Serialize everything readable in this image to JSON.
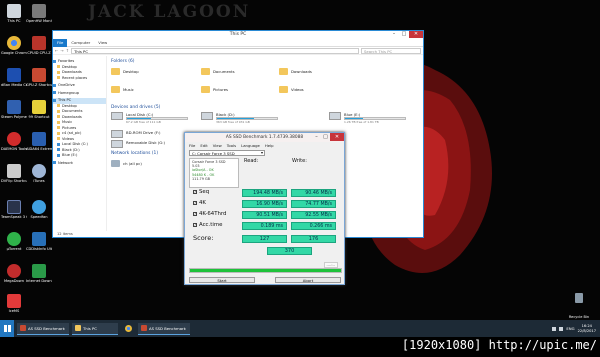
{
  "desktop": {
    "wallpaper_title": "JACK LAGOON",
    "icons_left": [
      {
        "label": "This PC",
        "color": "#cfd6dd"
      },
      {
        "label": "Google Chrome",
        "color": "#e7b83a"
      },
      {
        "label": "dBan Media Center 18",
        "color": "#1d4fb0"
      },
      {
        "label": "Steam Polymer",
        "color": "#3060b0"
      },
      {
        "label": "DAEMON Tools Lite",
        "color": "#d22c2c"
      },
      {
        "label": "DVFlip Shortcut",
        "color": "#cccccc"
      },
      {
        "label": "TeamSpeak 3 Client",
        "color": "#29334a"
      },
      {
        "label": "µTorrent",
        "color": "#2fb24a"
      },
      {
        "label": "MegaDown",
        "color": "#c22c2c"
      },
      {
        "label": "IceMS",
        "color": "#e23a3a"
      }
    ],
    "icons_col2": [
      {
        "label": "OpenHW Monitor",
        "color": "#7a7a7a"
      },
      {
        "label": "CPUID CPU-Z",
        "color": "#b8342a"
      },
      {
        "label": "GPU-Z Shortcut",
        "color": "#c84a32"
      },
      {
        "label": "99 Shortcut",
        "color": "#e7d13a"
      },
      {
        "label": "AIDA64 Extreme",
        "color": "#2a5fb0"
      },
      {
        "label": "iTunes",
        "color": "#9fb6d6"
      },
      {
        "label": "Speedfan",
        "color": "#40a0e0"
      },
      {
        "label": "CDDiskInfo Ultimate",
        "color": "#2870b8"
      },
      {
        "label": "Internet Downlo...",
        "color": "#2a9a48"
      }
    ],
    "recycle_bin": "Recycle Bin"
  },
  "explorer": {
    "title": "This PC",
    "ribbon_tabs": [
      "File",
      "Computer",
      "View"
    ],
    "address": "This PC",
    "search_placeholder": "Search This PC",
    "nav_items": [
      {
        "label": "Favorites",
        "type": "star"
      },
      {
        "label": "Desktop",
        "type": "folder"
      },
      {
        "label": "Downloads",
        "type": "folder"
      },
      {
        "label": "Recent places",
        "type": "folder"
      },
      {
        "label": "OneDrive",
        "type": "blue"
      },
      {
        "label": "Homegroup",
        "type": "blue"
      },
      {
        "label": "This PC",
        "type": "blue"
      },
      {
        "label": "Desktop",
        "type": "folder"
      },
      {
        "label": "Documents",
        "type": "folder"
      },
      {
        "label": "Downloads",
        "type": "folder"
      },
      {
        "label": "Music",
        "type": "folder"
      },
      {
        "label": "Pictures",
        "type": "folder"
      },
      {
        "label": "c4 (sd_pic)",
        "type": "folder"
      },
      {
        "label": "Videos",
        "type": "folder"
      },
      {
        "label": "Local Disk (C:)",
        "type": "blue"
      },
      {
        "label": "Black (D:)",
        "type": "blue"
      },
      {
        "label": "Blue (E:)",
        "type": "blue"
      },
      {
        "label": "Network",
        "type": "blue"
      }
    ],
    "folders_header": "Folders (6)",
    "folders": [
      "Desktop",
      "Documents",
      "Downloads",
      "Music",
      "Pictures",
      "Videos"
    ],
    "devices_header": "Devices and drives (5)",
    "drives": [
      {
        "name": "Local Disk (C:)",
        "space": "67.2 GB free of 111 GB",
        "used": 0.4
      },
      {
        "name": "Black (D:)",
        "space": "363 GB free of 931 GB",
        "used": 0.61
      },
      {
        "name": "Blue (E:)",
        "space": "1.26 TB free of 1.81 TB",
        "used": 0.3
      },
      {
        "name": "BD-ROM Drive (F:)",
        "space": "",
        "used": 0
      },
      {
        "name": "Removable Disk (G:)",
        "space": "",
        "used": 0
      }
    ],
    "network_header": "Network locations (1)",
    "network": [
      "ch (all pc)"
    ],
    "status": "12 items"
  },
  "asssd": {
    "title": "AS SSD Benchmark 1.7.4739.38088",
    "menu": [
      "File",
      "Edit",
      "View",
      "Tools",
      "Language",
      "Help"
    ],
    "drive": "C: Corsair Force 3 SSD",
    "info": [
      "Corsair Force 3 SSD",
      "5.03",
      "iaStor/A - OK",
      "54480 K - OK",
      "111.79 GB"
    ],
    "read_header": "Read:",
    "write_header": "Write:",
    "rows": [
      {
        "label": "Seq",
        "read": "194.48 MB/s",
        "write": "90.46 MB/s"
      },
      {
        "label": "4K",
        "read": "16.90 MB/s",
        "write": "74.77 MB/s"
      },
      {
        "label": "4K-64Thrd",
        "read": "90.51 MB/s",
        "write": "92.55 MB/s"
      },
      {
        "label": "Acc.time",
        "read": "0.189 ms",
        "write": "0.266 ms"
      }
    ],
    "score_label": "Score:",
    "score_read": "127",
    "score_write": "176",
    "score_total": "370",
    "progress": 1.0,
    "timer": "----:--",
    "start_label": "Start",
    "abort_label": "Abort"
  },
  "taskbar": {
    "items": [
      {
        "label": "AS SSD Benchmark",
        "color": "#c84a32"
      },
      {
        "label": "This PC",
        "color": "#f3c75c"
      },
      {
        "label": "AS SSD Benchmark",
        "color": "#c84a32"
      }
    ],
    "lang": "ENG",
    "time": "16:24",
    "date": "22/8/2017"
  },
  "watermark": "[1920x1080] http://upic.me/"
}
